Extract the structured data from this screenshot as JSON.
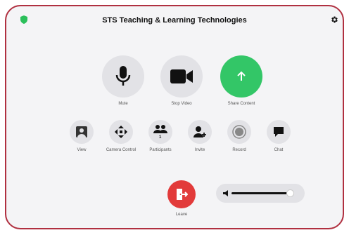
{
  "header": {
    "title": "STS Teaching & Learning Technologies",
    "shield_color": "#2bbf5a"
  },
  "main_controls": [
    {
      "id": "mute",
      "label": "Mute",
      "icon": "microphone-icon"
    },
    {
      "id": "stop-video",
      "label": "Stop Video",
      "icon": "video-camera-icon"
    },
    {
      "id": "share-content",
      "label": "Share Content",
      "icon": "arrow-up-icon",
      "accent": "#33c667"
    }
  ],
  "secondary_controls": [
    {
      "id": "view",
      "label": "View",
      "icon": "person-view-icon"
    },
    {
      "id": "camera-control",
      "label": "Camera Control",
      "icon": "move-arrows-icon"
    },
    {
      "id": "participants",
      "label": "Participants",
      "icon": "participants-icon",
      "count": "1"
    },
    {
      "id": "invite",
      "label": "Invite",
      "icon": "invite-user-icon"
    },
    {
      "id": "record",
      "label": "Record",
      "icon": "record-icon"
    },
    {
      "id": "chat",
      "label": "Chat",
      "icon": "chat-bubble-icon"
    }
  ],
  "leave": {
    "label": "Leave",
    "color": "#e23a3a",
    "icon": "exit-door-icon"
  },
  "volume": {
    "level": 0.85,
    "icon": "speaker-icon"
  },
  "frame_border_color": "#b03040"
}
